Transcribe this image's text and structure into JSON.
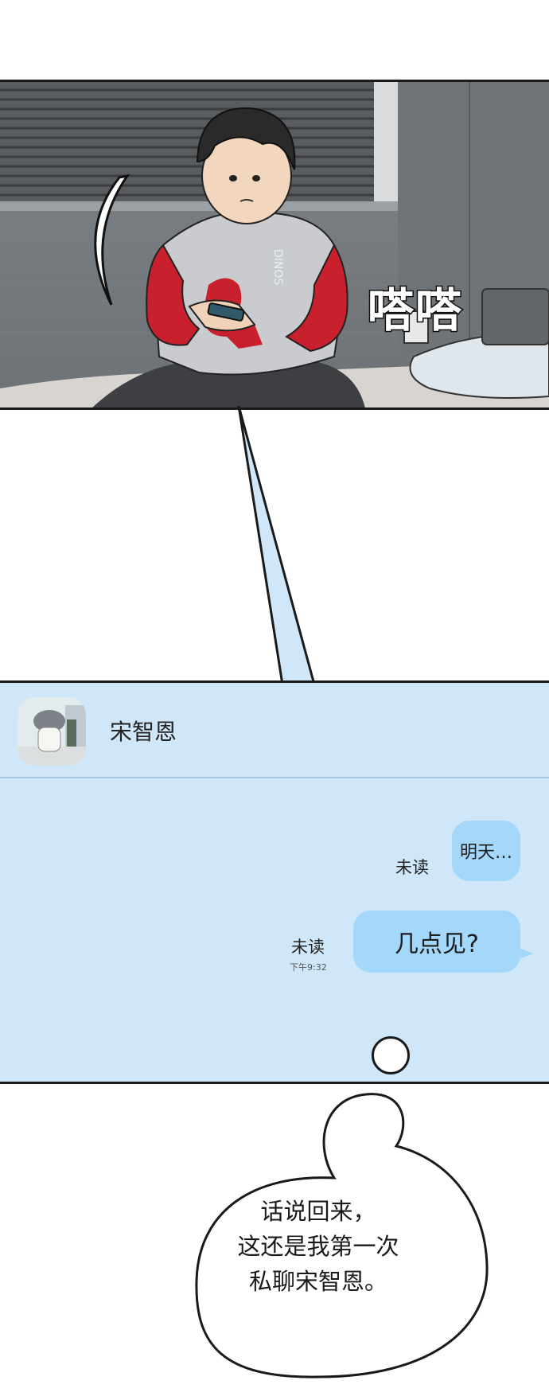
{
  "scene": {
    "sound_effect": "嗒嗒",
    "shirt_print": "DINOS"
  },
  "chat": {
    "contact_name": "宋智恩",
    "messages": [
      {
        "text": "明天…",
        "status": "未读",
        "time": ""
      },
      {
        "text": "几点见?",
        "status": "未读",
        "time": "下午9:32"
      }
    ]
  },
  "narration": {
    "lines": [
      "话说回来，",
      "这还是我第一次",
      "私聊宋智恩。"
    ]
  },
  "colors": {
    "chat_background": "#cfe7f8",
    "message_bubble": "#a3d8fb",
    "shirt_red": "#c8202c",
    "shirt_grey": "#c9cbce"
  }
}
